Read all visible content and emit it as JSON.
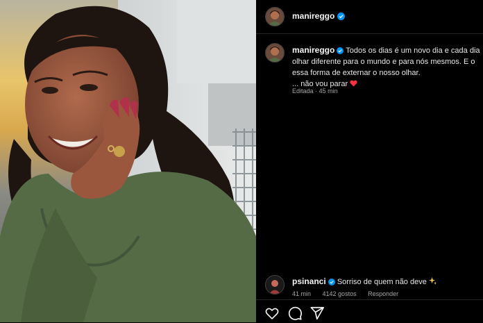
{
  "post": {
    "username": "manireggo",
    "caption_lines": [
      "Todos os dias é um novo dia e cada dia",
      "olhar diferente para o mundo e para nós mesmos. E o",
      "essa forma de externar o nosso olhar.",
      "... não vou parar"
    ],
    "edited_label": "Editada",
    "time_ago": "45 min"
  },
  "comment": {
    "username": "psinanci",
    "text": "Sorriso de quem não deve",
    "time_ago": "41 min",
    "likes": "4142 gostos",
    "reply_label": "Responder"
  },
  "icons": {
    "like": "heart-icon",
    "comment": "comment-bubble-icon",
    "share": "paper-plane-icon",
    "verified": "verified-badge-icon",
    "caption_heart": "red-heart-emoji",
    "sparkles": "sparkles-emoji"
  },
  "colors": {
    "background": "#000000",
    "verified": "#0095f6",
    "text": "#f5f5f5",
    "meta": "#a8a8a8",
    "heart": "#ff3040"
  }
}
